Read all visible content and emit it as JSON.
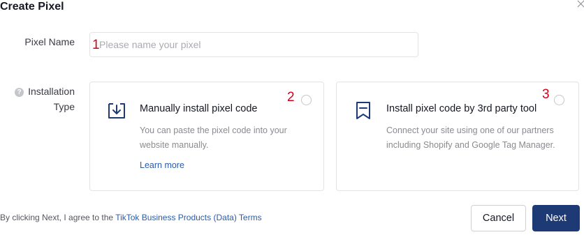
{
  "dialog": {
    "title": "Create Pixel"
  },
  "pixel_name": {
    "label": "Pixel Name",
    "placeholder": "Please name your pixel",
    "value": "",
    "marker": "1"
  },
  "installation_type": {
    "label_line1": "Installation",
    "label_line2": "Type",
    "help_icon": "question-circle-icon",
    "options": [
      {
        "icon": "download-box-icon",
        "title": "Manually install pixel code",
        "description": "You can paste the pixel code into your website manually.",
        "link": "Learn more",
        "marker": "2",
        "selected": false
      },
      {
        "icon": "bookmark-icon",
        "title": "Install pixel code by 3rd party tool",
        "description": "Connect your site using one of our partners including Shopify and Google Tag Manager.",
        "marker": "3",
        "selected": false
      }
    ]
  },
  "footer": {
    "agreement_prefix": "By clicking Next, I agree to the ",
    "agreement_link": "TikTok Business Products (Data) Terms",
    "cancel_label": "Cancel",
    "next_label": "Next"
  },
  "colors": {
    "primary": "#1d3a74",
    "link": "#2b5ba8",
    "marker": "#d0021b"
  }
}
